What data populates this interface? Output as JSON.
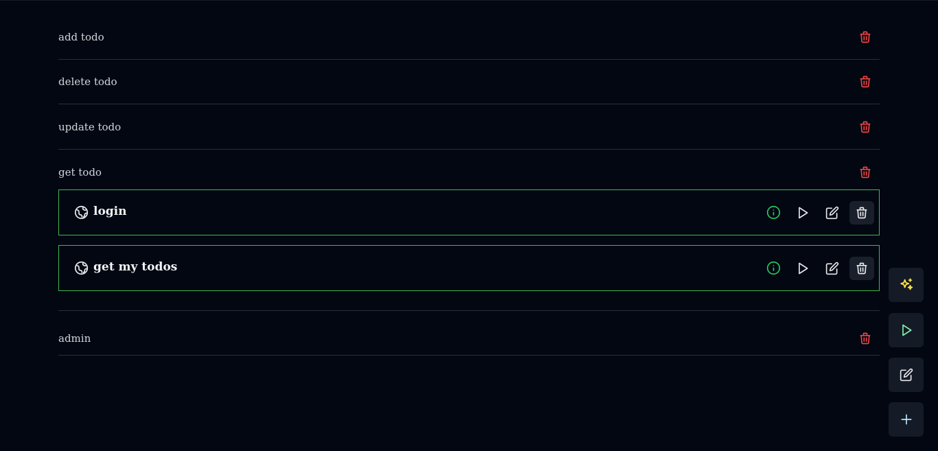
{
  "rows_top": [
    {
      "label": "add todo"
    },
    {
      "label": "delete todo"
    },
    {
      "label": "update todo"
    },
    {
      "label": "get todo"
    }
  ],
  "cards": [
    {
      "title": "login"
    },
    {
      "title": "get my todos"
    }
  ],
  "rows_bottom": [
    {
      "label": "admin"
    }
  ],
  "icons": {
    "row_action": "trash-icon",
    "card_leading": "globe-icon",
    "card_actions": [
      "info-icon",
      "play-icon",
      "edit-icon",
      "trash-icon"
    ],
    "fabs": [
      "sparkles-icon",
      "play-icon",
      "edit-icon",
      "plus-icon"
    ]
  },
  "colors": {
    "background": "#030712",
    "danger": "#ef4444",
    "success": "#22c55e",
    "card_border": "#3fb950",
    "sparkle": "#fde047",
    "play_fab": "#86efac",
    "plus_fab": "#bae6fd"
  }
}
